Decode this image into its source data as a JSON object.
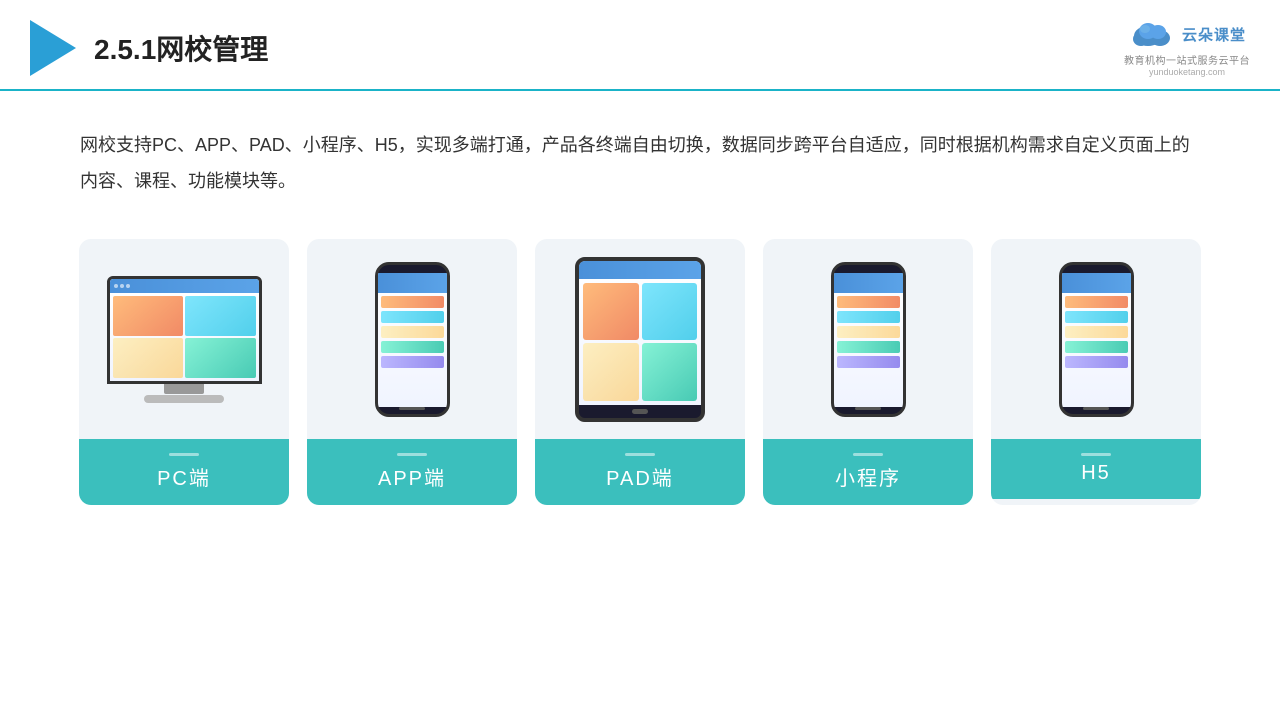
{
  "header": {
    "title": "2.5.1网校管理",
    "brand_name": "云朵课堂",
    "brand_url": "yunduoketang.com",
    "brand_tagline": "教育机构一站式服务云平台"
  },
  "description": {
    "text": "网校支持PC、APP、PAD、小程序、H5，实现多端打通，产品各终端自由切换，数据同步跨平台自适应，同时根据机构需求自定义页面上的内容、课程、功能模块等。"
  },
  "cards": [
    {
      "id": "pc",
      "label": "PC端"
    },
    {
      "id": "app",
      "label": "APP端"
    },
    {
      "id": "pad",
      "label": "PAD端"
    },
    {
      "id": "miniprogram",
      "label": "小程序"
    },
    {
      "id": "h5",
      "label": "H5"
    }
  ],
  "colors": {
    "accent": "#3bbfbd",
    "header_border": "#1ab3c8",
    "arrow": "#2a9fd6",
    "brand_blue": "#4a8ec9"
  }
}
